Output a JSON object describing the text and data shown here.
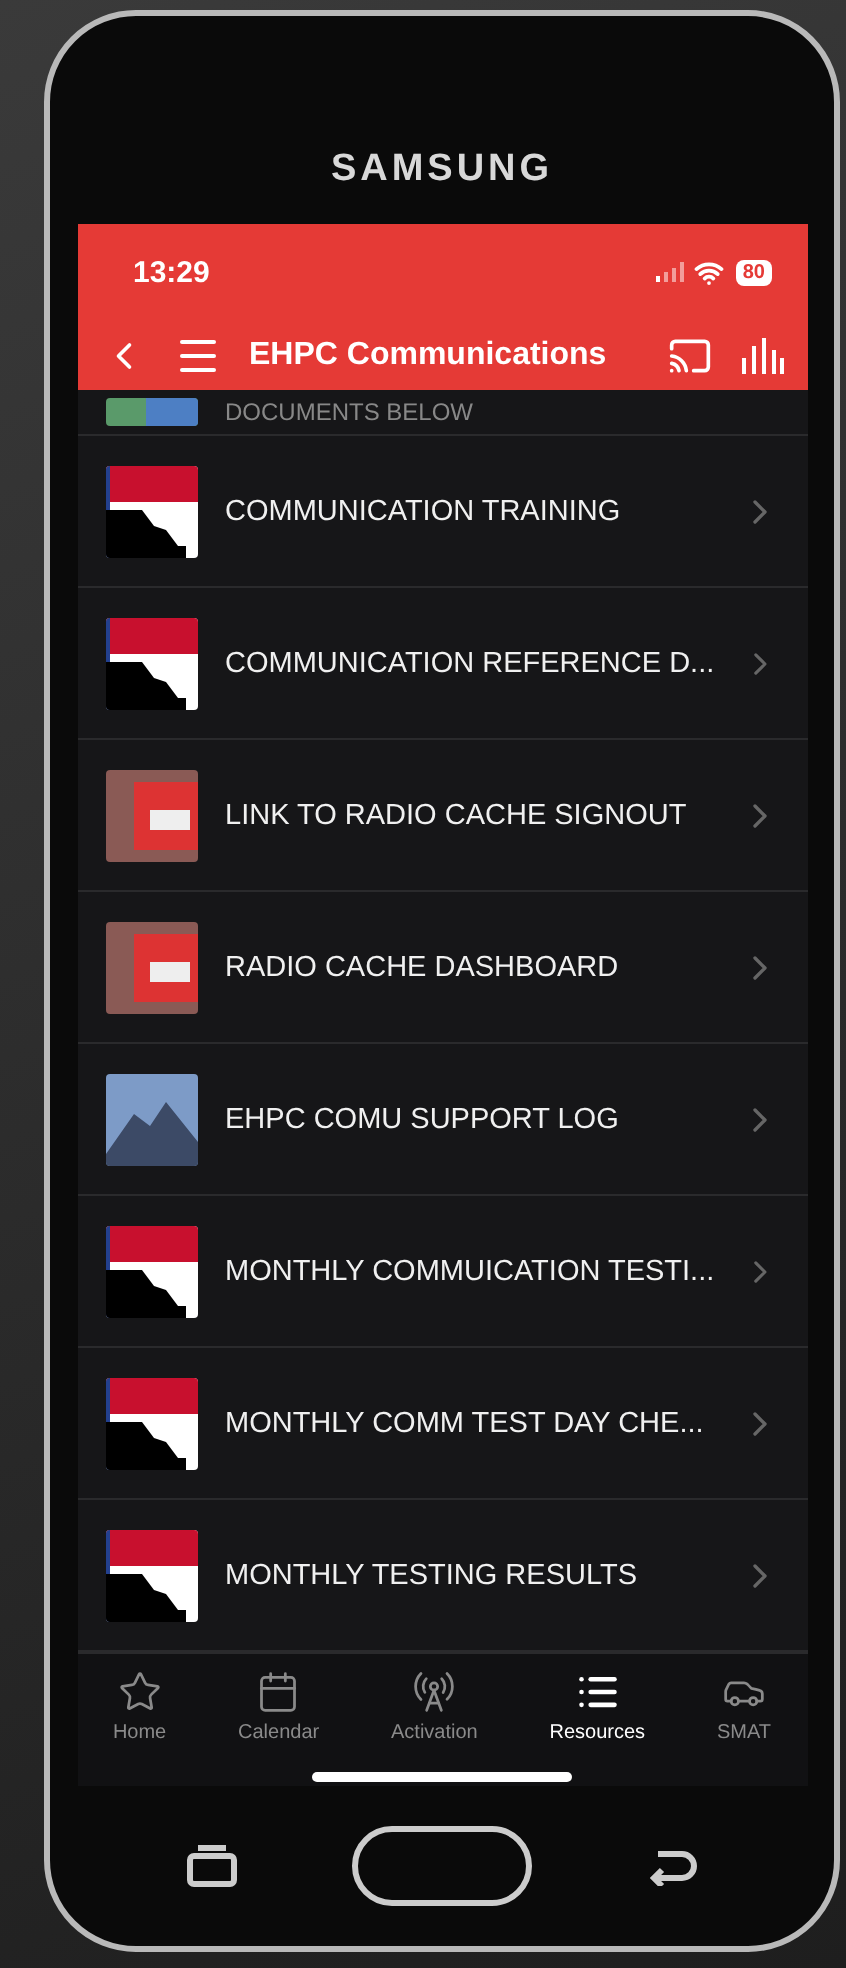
{
  "device": {
    "brand": "SAMSUNG"
  },
  "status_bar": {
    "time": "13:29",
    "battery": "80"
  },
  "header": {
    "title": "EHPC Communications"
  },
  "items": [
    {
      "title": "DOCUMENTS BELOW",
      "kind": "map"
    },
    {
      "title": "COMMUNICATION TRAINING",
      "kind": "logo"
    },
    {
      "title": "COMMUNICATION REFERENCE D...",
      "kind": "logo"
    },
    {
      "title": "LINK TO RADIO CACHE SIGNOUT",
      "kind": "vehicle"
    },
    {
      "title": "RADIO CACHE DASHBOARD",
      "kind": "vehicle"
    },
    {
      "title": "EHPC COMU SUPPORT LOG",
      "kind": "mountain"
    },
    {
      "title": "MONTHLY COMMUICATION TESTI...",
      "kind": "logo"
    },
    {
      "title": "MONTHLY COMM TEST DAY CHE...",
      "kind": "logo"
    },
    {
      "title": "MONTHLY TESTING RESULTS",
      "kind": "logo"
    }
  ],
  "tabs": [
    {
      "label": "Home",
      "selected": false
    },
    {
      "label": "Calendar",
      "selected": false
    },
    {
      "label": "Activation",
      "selected": false
    },
    {
      "label": "Resources",
      "selected": true
    },
    {
      "label": "SMAT",
      "selected": false
    }
  ]
}
